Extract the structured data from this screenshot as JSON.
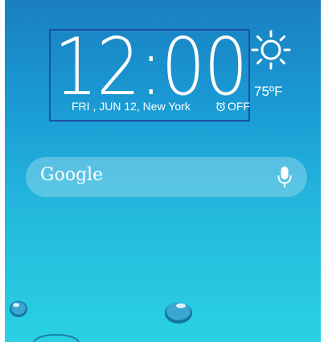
{
  "clock": {
    "time": "12:00",
    "date": "FRI , JUN 12, New York",
    "alarm_status": "OFF"
  },
  "weather": {
    "temperature": "75ºF",
    "icon": "sun-icon"
  },
  "search": {
    "brand": "Google",
    "mic_icon": "microphone-icon"
  }
}
